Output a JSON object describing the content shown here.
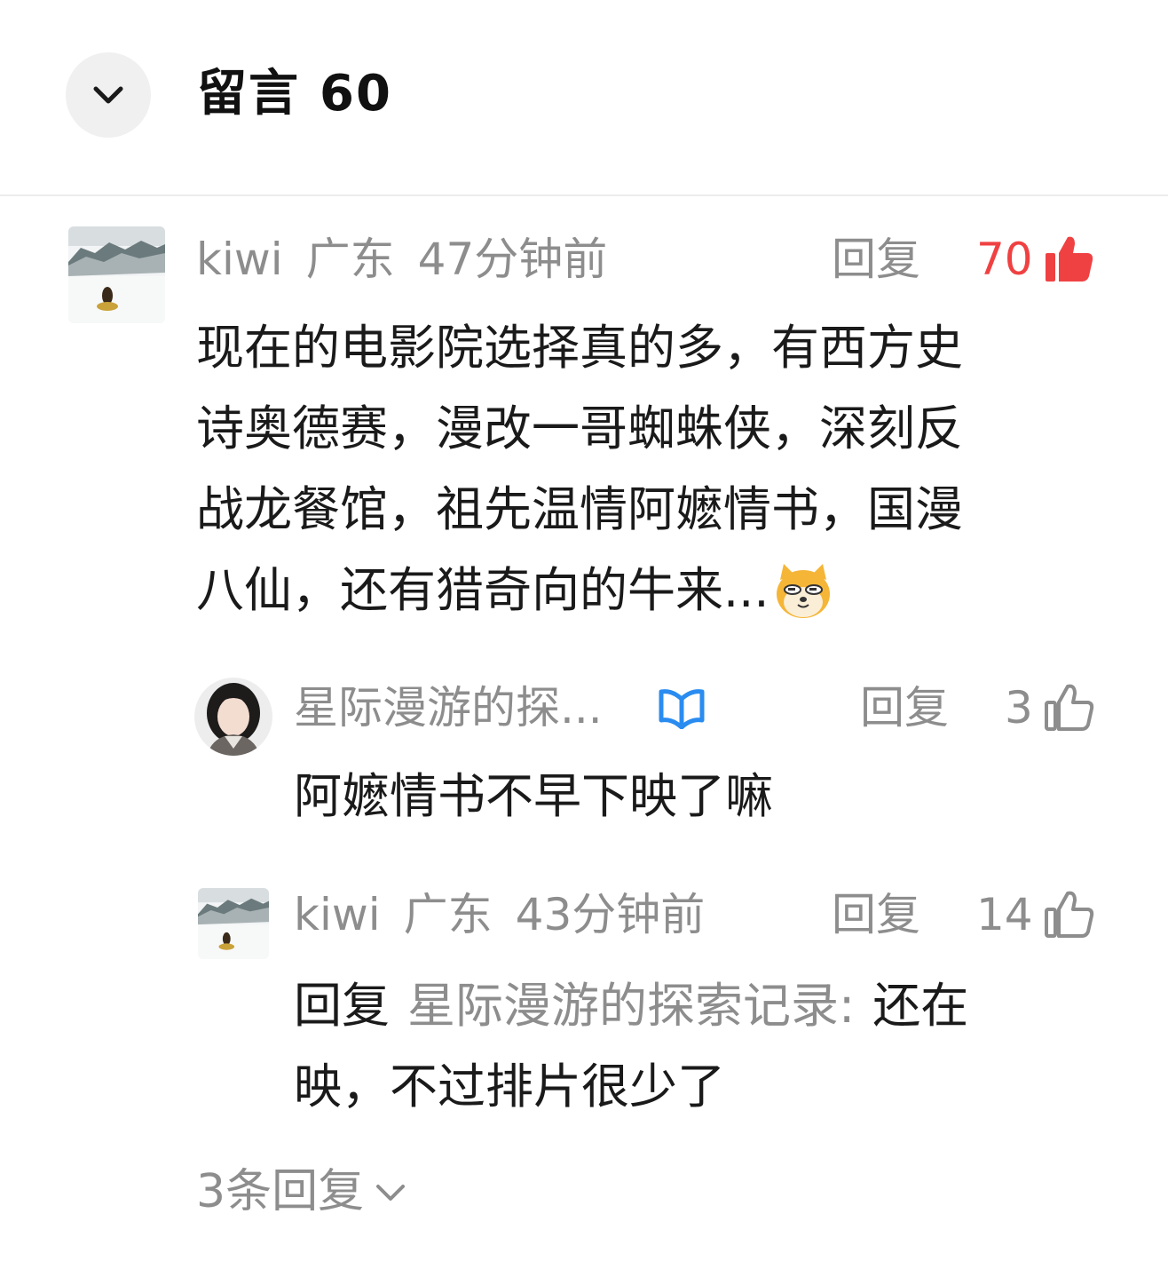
{
  "header": {
    "title": "留言",
    "count": "60"
  },
  "comment": {
    "user": "kiwi",
    "location": "广东",
    "time": "47分钟前",
    "reply_label": "回复",
    "likes": "70",
    "text_lines": [
      "现在的电影院选择真的多，有西方史",
      "诗奥德赛，漫改一哥蜘蛛侠，深刻反",
      "战龙餐馆，祖先温情阿嬷情书，国漫",
      "八仙，还有猎奇向的牛来..."
    ]
  },
  "replies": [
    {
      "user": "星际漫游的探...",
      "reply_label": "回复",
      "likes": "3",
      "text": "阿嬷情书不早下映了嘛"
    },
    {
      "user": "kiwi",
      "location": "广东",
      "time": "43分钟前",
      "reply_label": "回复",
      "likes": "14",
      "reply_prefix": "回复",
      "reply_target": "星际漫游的探索记录:",
      "text_line1": "还在",
      "text_line2": "映，不过排片很少了"
    }
  ],
  "more_replies": "3条回复",
  "colors": {
    "like_active": "#f04142",
    "meta_gray": "#8d8d8d",
    "verified_blue": "#2a8cf0"
  }
}
